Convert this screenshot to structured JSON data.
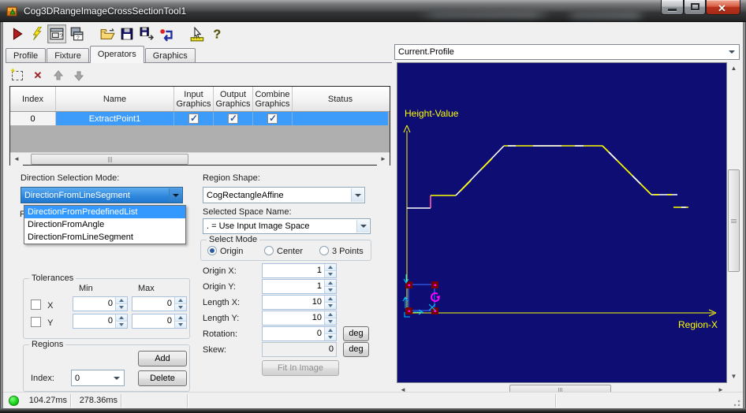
{
  "window": {
    "title": "Cog3DRangeImageCrossSectionTool1",
    "controls": [
      "minimize",
      "maximize",
      "close"
    ]
  },
  "main_toolbar": {
    "icons": [
      "run",
      "run-once",
      "show-result-image",
      "float-window",
      "open-file",
      "save",
      "save-as",
      "reset",
      "pixel-ruler",
      "help"
    ]
  },
  "tabs": {
    "items": [
      "Profile",
      "Fixture",
      "Operators",
      "Graphics"
    ],
    "active": "Operators"
  },
  "operators_panel": {
    "toolbar_icons": [
      "add-operator",
      "delete-operator",
      "move-up",
      "move-down"
    ],
    "table": {
      "headers": [
        "Index",
        "Name",
        "Input Graphics",
        "Output Graphics",
        "Combine Graphics",
        "Status"
      ],
      "rows": [
        {
          "index": "0",
          "name": "ExtractPoint1",
          "input_graphics": true,
          "output_graphics": true,
          "combine_graphics": true,
          "status": ""
        }
      ]
    }
  },
  "direction": {
    "label": "Direction Selection Mode:",
    "value": "DirectionFromLineSegment",
    "options": [
      "DirectionFromPredefinedList",
      "DirectionFromAngle",
      "DirectionFromLineSegment"
    ],
    "highlighted_option": "DirectionFromPredefinedList",
    "hidden_label_fragment": "F"
  },
  "region_shape": {
    "label": "Region Shape:",
    "value": "CogRectangleAffine",
    "space_label": "Selected Space Name:",
    "space_value": ". = Use Input Image Space",
    "select_mode": {
      "title": "Select Mode",
      "options": [
        "Origin",
        "Center",
        "3 Points"
      ],
      "selected": "Origin"
    },
    "fields": [
      {
        "label": "Origin X:",
        "value": "1"
      },
      {
        "label": "Origin Y:",
        "value": "1"
      },
      {
        "label": "Length X:",
        "value": "10"
      },
      {
        "label": "Length Y:",
        "value": "10"
      },
      {
        "label": "Rotation:",
        "value": "0",
        "unit": "deg"
      },
      {
        "label": "Skew:",
        "value": "0",
        "unit": "deg",
        "disabled": true
      }
    ],
    "deg_label": "deg",
    "fit_button": "Fit In Image"
  },
  "tolerances": {
    "title": "Tolerances",
    "col_min": "Min",
    "col_max": "Max",
    "rows": [
      {
        "label": "X",
        "checked": false,
        "min": "0",
        "max": "0"
      },
      {
        "label": "Y",
        "checked": false,
        "min": "0",
        "max": "0"
      }
    ]
  },
  "regions_group": {
    "title": "Regions",
    "add_button": "Add",
    "delete_button": "Delete",
    "index_label": "Index:",
    "index_value": "0"
  },
  "display": {
    "selector_value": "Current.Profile",
    "y_axis_label": "Height-Value",
    "x_axis_label": "Region-X",
    "background": "#0d0d73",
    "profile_segments": [
      {
        "color": "#ffffff",
        "points": [
          [
            12,
            184
          ],
          [
            42,
            184
          ]
        ]
      },
      {
        "color": "#ff5fa8",
        "points": [
          [
            42,
            184
          ],
          [
            42,
            168
          ]
        ]
      },
      {
        "color": "#ffff00",
        "points": [
          [
            42,
            168
          ],
          [
            74,
            168
          ]
        ]
      },
      {
        "color": "#ffffff",
        "points": [
          [
            74,
            168
          ],
          [
            135,
            105
          ]
        ]
      },
      {
        "color": "#ffff00",
        "points": [
          [
            79,
            163
          ],
          [
            93,
            149
          ]
        ]
      },
      {
        "color": "#ffff00",
        "points": [
          [
            106,
            135
          ],
          [
            120,
            121
          ]
        ]
      },
      {
        "color": "#ffff00",
        "points": [
          [
            135,
            105
          ],
          [
            260,
            105
          ]
        ]
      },
      {
        "color": "#ffffff",
        "points": [
          [
            140,
            105
          ],
          [
            150,
            105
          ]
        ]
      },
      {
        "color": "#ffffff",
        "points": [
          [
            172,
            105
          ],
          [
            208,
            105
          ]
        ]
      },
      {
        "color": "#ffffff",
        "points": [
          [
            225,
            105
          ],
          [
            236,
            105
          ]
        ]
      },
      {
        "color": "#ffff00",
        "points": [
          [
            260,
            105
          ],
          [
            322,
            167
          ]
        ]
      },
      {
        "color": "#ffffff",
        "points": [
          [
            268,
            113
          ],
          [
            278,
            123
          ]
        ]
      },
      {
        "color": "#ffffff",
        "points": [
          [
            298,
            143
          ],
          [
            308,
            153
          ]
        ]
      },
      {
        "color": "#ffffff",
        "points": [
          [
            322,
            167
          ],
          [
            355,
            167
          ]
        ]
      },
      {
        "color": "#ffff00",
        "points": [
          [
            325,
            167
          ],
          [
            332,
            167
          ]
        ]
      },
      {
        "color": "#ffff00",
        "points": [
          [
            342,
            167
          ],
          [
            348,
            167
          ]
        ]
      },
      {
        "color": "#ffff00",
        "points": [
          [
            350,
            183
          ],
          [
            369,
            183
          ]
        ]
      },
      {
        "color": "#ffffff",
        "points": [
          [
            360,
            183
          ],
          [
            366,
            183
          ]
        ]
      }
    ]
  },
  "status_bar": {
    "run_time": "104.27ms",
    "total_time": "278.36ms"
  },
  "colors": {
    "selection": "#3399ff",
    "navy": "#0d0d73",
    "axis_yellow": "#ffff00",
    "handle_red": "#7a0000",
    "widget_blue": "#2e52d8",
    "cyan": "#00c8ff",
    "magenta": "#ff00ff"
  }
}
